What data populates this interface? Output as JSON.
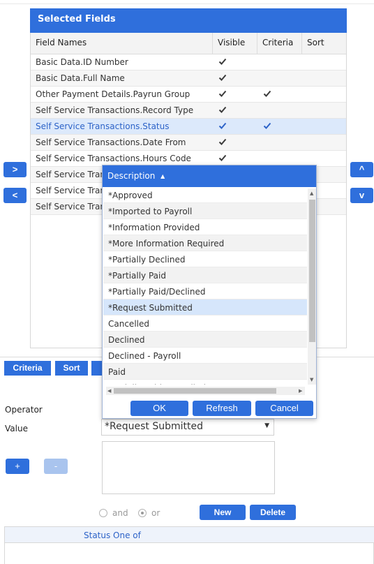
{
  "selected_fields": {
    "title": "Selected Fields",
    "columns": [
      "Field Names",
      "Visible",
      "Criteria",
      "Sort"
    ],
    "rows": [
      {
        "name": "Basic Data.ID Number",
        "visible": true,
        "criteria": false
      },
      {
        "name": "Basic Data.Full Name",
        "visible": true,
        "criteria": false
      },
      {
        "name": "Other Payment Details.Payrun Group",
        "visible": true,
        "criteria": true
      },
      {
        "name": "Self Service Transactions.Record Type",
        "visible": true,
        "criteria": false
      },
      {
        "name": "Self Service Transactions.Status",
        "visible": true,
        "criteria": true,
        "selected": true
      },
      {
        "name": "Self Service Transactions.Date From",
        "visible": true,
        "criteria": false
      },
      {
        "name": "Self Service Transactions.Hours Code",
        "visible": true,
        "criteria": false
      },
      {
        "name": "Self Service Trans",
        "visible": false,
        "criteria": false
      },
      {
        "name": "Self Service Trans",
        "visible": false,
        "criteria": false
      },
      {
        "name": "Self Service Trans",
        "visible": false,
        "criteria": false
      }
    ]
  },
  "side_buttons": {
    "add": ">",
    "remove": "<",
    "up": "^",
    "down": "v"
  },
  "popup": {
    "header": "Description",
    "options": [
      "*Approved",
      "*Imported to Payroll",
      "*Information Provided",
      "*More Information Required",
      "*Partially Declined",
      "*Partially Paid",
      "*Partially Paid/Declined",
      "*Request Submitted",
      "Cancelled",
      "Declined",
      "Declined - Payroll",
      "Paid",
      "Partially Paid/Cancelled"
    ],
    "selected_index": 7,
    "ok": "OK",
    "refresh": "Refresh",
    "cancel": "Cancel"
  },
  "tabs": [
    "Criteria",
    "Sort",
    ""
  ],
  "form": {
    "operator_label": "Operator",
    "value_label": "Value",
    "value_selected": "*Request Submitted",
    "plus": "+",
    "minus": "-",
    "and_label": "and",
    "or_label": "or",
    "new": "New",
    "delete": "Delete"
  },
  "criteria_grid": {
    "column": "Status One of"
  },
  "colors": {
    "accent": "#2f6fdc",
    "selected_row": "#dce9fb"
  }
}
